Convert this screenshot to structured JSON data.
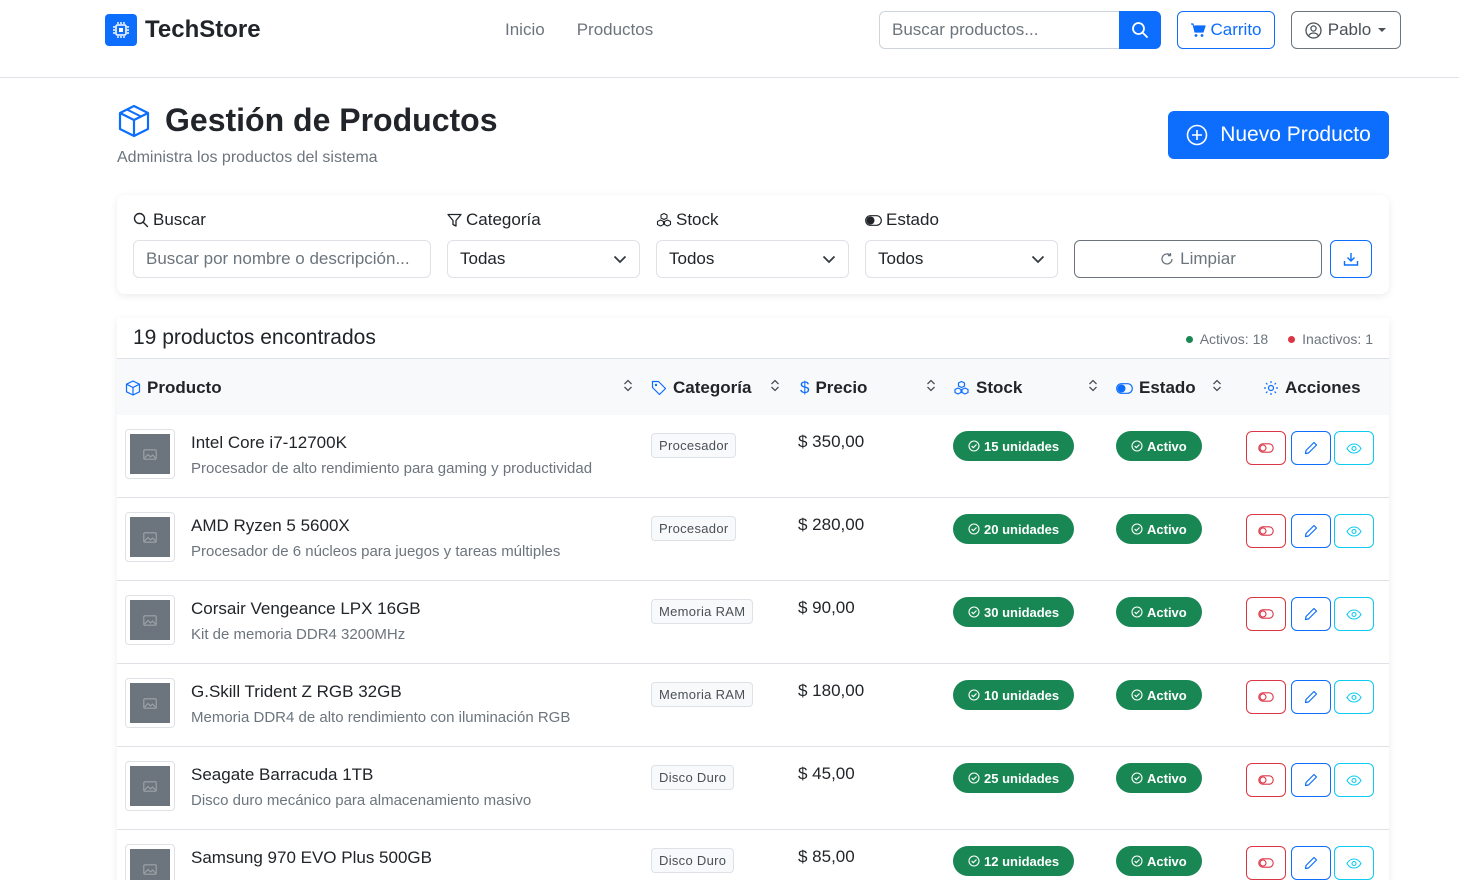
{
  "navbar": {
    "brand": "TechStore",
    "links": [
      "Inicio",
      "Productos"
    ],
    "search_placeholder": "Buscar productos...",
    "cart_label": "Carrito",
    "user_label": "Pablo"
  },
  "header": {
    "title": "Gestión de Productos",
    "subtitle": "Administra los productos del sistema",
    "new_button": "Nuevo Producto"
  },
  "filters": {
    "search_label": "Buscar",
    "search_placeholder": "Buscar por nombre o descripción...",
    "category_label": "Categoría",
    "category_value": "Todas",
    "stock_label": "Stock",
    "stock_value": "Todos",
    "status_label": "Estado",
    "status_value": "Todos",
    "clear_label": "Limpiar"
  },
  "table": {
    "count_text": "19 productos encontrados",
    "active_text": "Activos: 18",
    "inactive_text": "Inactivos: 1",
    "columns": {
      "product": "Producto",
      "category": "Categoría",
      "price": "Precio",
      "stock": "Stock",
      "status": "Estado",
      "actions": "Acciones"
    },
    "rows": [
      {
        "name": "Intel Core i7-12700K",
        "description": "Procesador de alto rendimiento para gaming y productividad",
        "category": "Procesador",
        "price": "$ 350,00",
        "stock": "15 unidades",
        "status": "Activo"
      },
      {
        "name": "AMD Ryzen 5 5600X",
        "description": "Procesador de 6 núcleos para juegos y tareas múltiples",
        "category": "Procesador",
        "price": "$ 280,00",
        "stock": "20 unidades",
        "status": "Activo"
      },
      {
        "name": "Corsair Vengeance LPX 16GB",
        "description": "Kit de memoria DDR4 3200MHz",
        "category": "Memoria RAM",
        "price": "$ 90,00",
        "stock": "30 unidades",
        "status": "Activo"
      },
      {
        "name": "G.Skill Trident Z RGB 32GB",
        "description": "Memoria DDR4 de alto rendimiento con iluminación RGB",
        "category": "Memoria RAM",
        "price": "$ 180,00",
        "stock": "10 unidades",
        "status": "Activo"
      },
      {
        "name": "Seagate Barracuda 1TB",
        "description": "Disco duro mecánico para almacenamiento masivo",
        "category": "Disco Duro",
        "price": "$ 45,00",
        "stock": "25 unidades",
        "status": "Activo"
      },
      {
        "name": "Samsung 970 EVO Plus 500GB",
        "description": "",
        "category": "Disco Duro",
        "price": "$ 85,00",
        "stock": "12 unidades",
        "status": "Activo"
      }
    ]
  },
  "colors": {
    "primary": "#0d6efd",
    "success": "#198754",
    "danger": "#dc3545",
    "info": "#0dcaf0",
    "muted": "#6c757d"
  }
}
